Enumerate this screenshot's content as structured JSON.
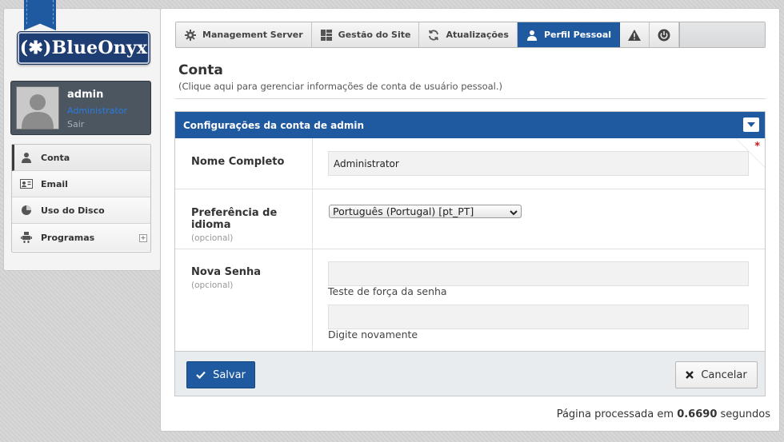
{
  "brand": {
    "logo_text": "(✱)BlueOnyx"
  },
  "user": {
    "name": "admin",
    "role": "Administrator",
    "logout": "Sair"
  },
  "sidebar": {
    "items": [
      {
        "label": "Conta",
        "icon": "user-icon",
        "active": true
      },
      {
        "label": "Email",
        "icon": "email-icon"
      },
      {
        "label": "Uso do Disco",
        "icon": "pie-chart-icon"
      },
      {
        "label": "Programas",
        "icon": "robot-icon",
        "expandable": true,
        "expand_glyph": "+"
      }
    ]
  },
  "tabs": [
    {
      "label": "Management Server",
      "icon": "gear-icon"
    },
    {
      "label": "Gestão do Site",
      "icon": "grid-icon"
    },
    {
      "label": "Atualizações",
      "icon": "refresh-icon"
    },
    {
      "label": "Perfil Pessoal",
      "icon": "user-icon",
      "active": true
    },
    {
      "label": "",
      "icon": "warning-icon"
    },
    {
      "label": "",
      "icon": "power-icon"
    }
  ],
  "page": {
    "title": "Conta",
    "subtitle": "(Clique aqui para gerenciar informações de conta de usuário pessoal.)"
  },
  "form": {
    "header": "Configurações da conta de admin",
    "required_marker": "*",
    "fields": {
      "full_name": {
        "label": "Nome Completo",
        "value": "Administrator"
      },
      "language": {
        "label": "Preferência de idioma",
        "optional": "(opcional)",
        "value": "Português (Portugal) [pt_PT]"
      },
      "password": {
        "label": "Nova Senha",
        "optional": "(opcional)",
        "strength_help": "Teste de força da senha",
        "retype_help": "Digite novamente"
      }
    }
  },
  "actions": {
    "save": "Salvar",
    "cancel": "Cancelar"
  },
  "footer": {
    "prefix": "Página processada em",
    "time": "0.6690",
    "suffix": "segundos"
  },
  "colors": {
    "accent": "#1f5aa0",
    "required": "#c81d1d",
    "role_link": "#2a7ce0"
  }
}
